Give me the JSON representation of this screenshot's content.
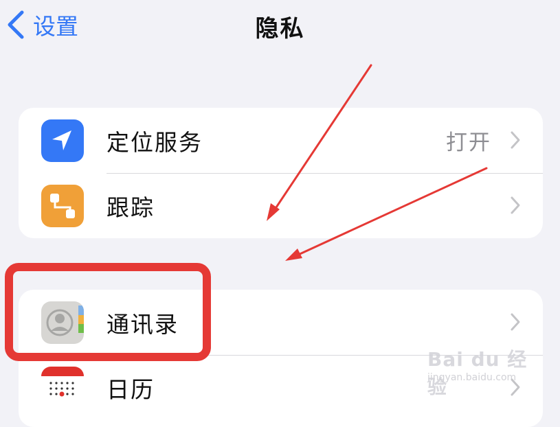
{
  "navbar": {
    "back_label": "设置",
    "title": "隐私"
  },
  "groups": [
    {
      "rows": [
        {
          "label": "定位服务",
          "value": "打开",
          "icon": "location-arrow-icon",
          "icon_color": "#3478f6"
        },
        {
          "label": "跟踪",
          "value": "",
          "icon": "tracking-icon",
          "icon_color": "#f0a038"
        }
      ]
    },
    {
      "rows": [
        {
          "label": "通讯录",
          "value": "",
          "icon": "contacts-icon",
          "icon_color": "#d7d6d3"
        },
        {
          "label": "日历",
          "value": "",
          "icon": "calendar-icon",
          "icon_color": "#e0312c"
        }
      ]
    }
  ],
  "colors": {
    "accent": "#3478f6",
    "annotation": "#e53935",
    "background": "#f2f2f7"
  },
  "watermark": {
    "logo": "Bai du 经验",
    "url": "jingyan.baidu.com"
  }
}
